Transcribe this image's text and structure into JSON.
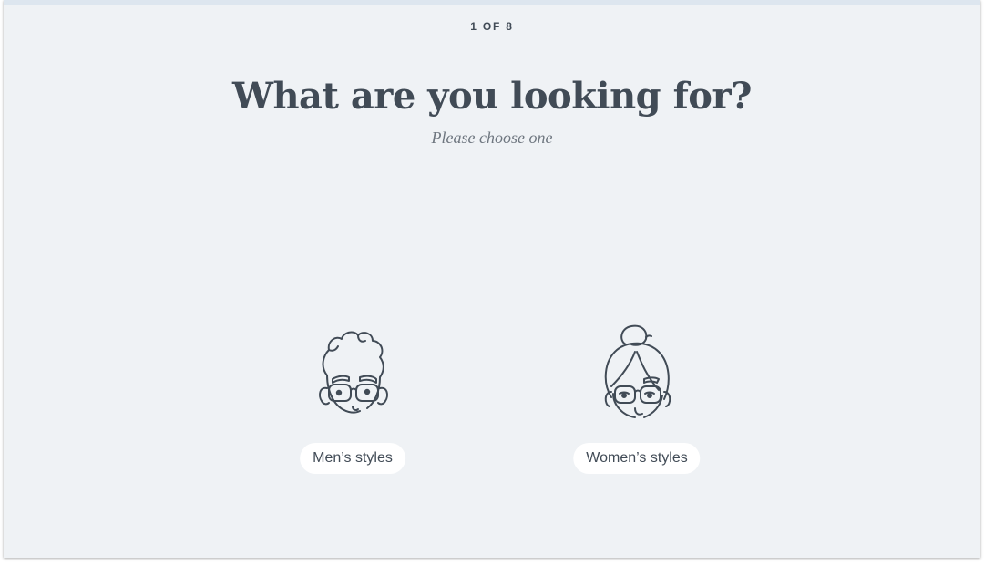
{
  "progress": {
    "current": 1,
    "total": 8,
    "label": "1 OF 8"
  },
  "heading": {
    "title": "What are you looking for?",
    "subtitle": "Please choose one"
  },
  "options": [
    {
      "label": "Men’s styles",
      "icon": "man-with-glasses-icon"
    },
    {
      "label": "Women’s styles",
      "icon": "woman-with-glasses-icon"
    }
  ],
  "colors": {
    "background": "#eff2f5",
    "text": "#414b56",
    "muted": "#6f7780",
    "pill": "#ffffff"
  }
}
